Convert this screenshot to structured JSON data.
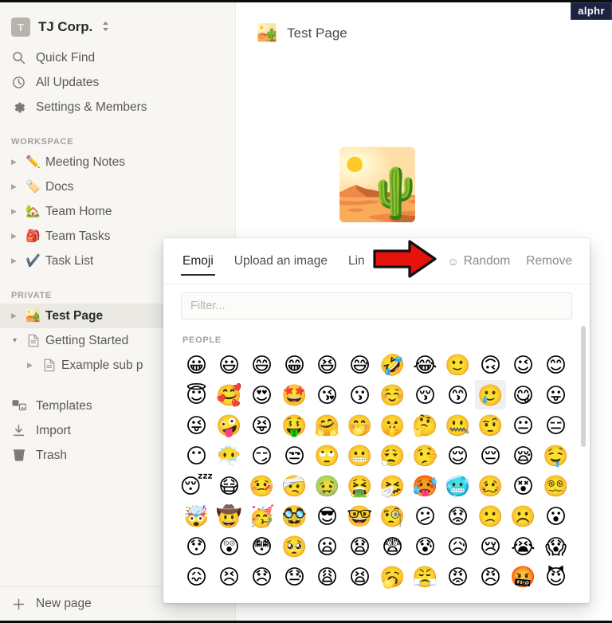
{
  "watermark": {
    "label": "alphr"
  },
  "sidebar": {
    "workspace": {
      "avatar_letter": "T",
      "name": "TJ Corp.",
      "chevron": "⌃⌄"
    },
    "nav": [
      {
        "label": "Quick Find",
        "icon": "search-icon"
      },
      {
        "label": "All Updates",
        "icon": "clock-icon"
      },
      {
        "label": "Settings & Members",
        "icon": "gear-icon"
      }
    ],
    "workspace_section": {
      "label": "WORKSPACE",
      "pages": [
        {
          "label": "Meeting Notes",
          "emoji": "✏️"
        },
        {
          "label": "Docs",
          "emoji": "🏷️"
        },
        {
          "label": "Team Home",
          "emoji": "🏡"
        },
        {
          "label": "Team Tasks",
          "emoji": "🎒"
        },
        {
          "label": "Task List",
          "emoji": "✔️"
        }
      ]
    },
    "private_section": {
      "label": "PRIVATE",
      "pages": [
        {
          "label": "Test Page",
          "emoji": "🏜️",
          "selected": true
        },
        {
          "label": "Getting Started",
          "icon": "document-icon",
          "expanded": true
        },
        {
          "label": "Example sub p",
          "icon": "document-icon",
          "indent": true
        }
      ]
    },
    "lower": [
      {
        "label": "Templates",
        "icon": "templates-icon"
      },
      {
        "label": "Import",
        "icon": "import-icon"
      },
      {
        "label": "Trash",
        "icon": "trash-icon"
      }
    ],
    "new_page": {
      "label": "New page",
      "icon": "plus-icon"
    }
  },
  "main": {
    "page": {
      "title": "Test Page",
      "emoji": "🏜️"
    },
    "hero_emoji": "🏜️"
  },
  "picker": {
    "tabs": [
      {
        "label": "Emoji",
        "active": true
      },
      {
        "label": "Upload an image",
        "active": false
      },
      {
        "label": "Lin",
        "active": false
      }
    ],
    "random": {
      "label": "Random",
      "icon": "smiley-icon",
      "glyph": "☺"
    },
    "remove": {
      "label": "Remove"
    },
    "filter": {
      "value": "",
      "placeholder": "Filter..."
    },
    "category": {
      "label": "PEOPLE"
    },
    "emoji_rows": [
      [
        "😀",
        "😃",
        "😄",
        "😁",
        "😆",
        "😅",
        "🤣",
        "😂",
        "🙂",
        "🙃",
        "😉",
        "😊"
      ],
      [
        "😇",
        "🥰",
        "😍",
        "🤩",
        "😘",
        "😗",
        "☺️",
        "😚",
        "😙",
        "🥲",
        "😋",
        "😛"
      ],
      [
        "😜",
        "🤪",
        "😝",
        "🤑",
        "🤗",
        "🤭",
        "🤫",
        "🤔",
        "🤐",
        "🤨",
        "😐",
        "😑"
      ],
      [
        "😶",
        "😶‍🌫️",
        "😏",
        "😒",
        "🙄",
        "😬",
        "😮‍💨",
        "🤥",
        "😌",
        "😔",
        "😪",
        "🤤"
      ],
      [
        "😴",
        "😷",
        "🤒",
        "🤕",
        "🤢",
        "🤮",
        "🤧",
        "🥵",
        "🥶",
        "🥴",
        "😵",
        "😵‍💫"
      ],
      [
        "🤯",
        "🤠",
        "🥳",
        "🥸",
        "😎",
        "🤓",
        "🧐",
        "😕",
        "😟",
        "🙁",
        "☹️",
        "😮"
      ],
      [
        "😯",
        "😲",
        "😳",
        "🥺",
        "😦",
        "😧",
        "😨",
        "😰",
        "😥",
        "😢",
        "😭",
        "😱"
      ],
      [
        "😖",
        "😣",
        "😞",
        "😓",
        "😩",
        "😫",
        "🥱",
        "😤",
        "😡",
        "😠",
        "🤬",
        "😈"
      ]
    ],
    "highlighted_cell": {
      "row": 1,
      "col": 9
    },
    "scrollbar": {
      "visible": true
    }
  },
  "annotation": {
    "arrow": "red-right-arrow",
    "color": "#e8120d"
  }
}
